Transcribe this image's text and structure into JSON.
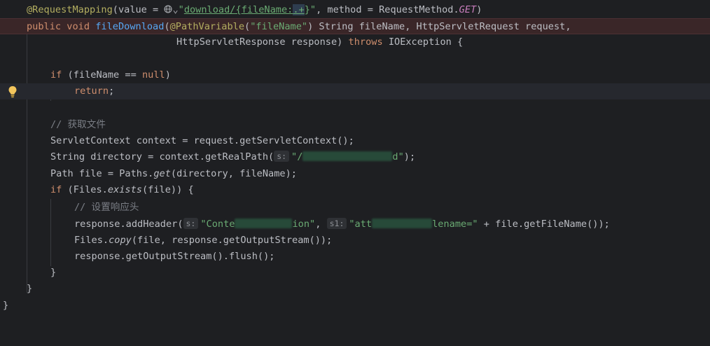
{
  "editor": {
    "lines": {
      "l1": {
        "annotation": "@RequestMapping",
        "p1": "(value = ",
        "chevron": "⌄",
        "q1": "\"",
        "path_a": "download/{fileName:",
        "regex": ".+",
        "path_b": "}\"",
        "p2": ", method = RequestMethod.",
        "get": "GET",
        "p3": ")"
      },
      "l2": {
        "kw_public": "public",
        "kw_void": " void ",
        "method": "fileDownload",
        "p1": "(",
        "path_var": "@PathVariable",
        "p2": "(",
        "str": "\"fileName\"",
        "p3": ") String fileName, HttpServletRequest request,"
      },
      "l3": {
        "p1": "HttpServletResponse response) ",
        "kw_throws": "throws",
        "p2": " IOException {"
      },
      "l4": {
        "kw_if": "if",
        "p1": " (fileName == ",
        "kw_null": "null",
        "p2": ")"
      },
      "l5": {
        "kw_return": "return",
        "p1": ";"
      },
      "l6": {
        "comment": "// 获取文件"
      },
      "l7": {
        "text": "ServletContext context = request.getServletContext();"
      },
      "l8": {
        "p1": "String directory = context.getRealPath(",
        "hint": "s:",
        "str_a": "\"/",
        "str_b": "d\"",
        "p2": ");"
      },
      "l9": {
        "p1": "Path file = Paths.",
        "get": "get",
        "p2": "(directory, fileName);"
      },
      "l10": {
        "kw_if": "if",
        "p1": " (Files.",
        "exists": "exists",
        "p2": "(file)) {"
      },
      "l11": {
        "comment": "// 设置响应头"
      },
      "l12": {
        "p1": "response.addHeader(",
        "hint1": "s:",
        "str1_a": "\"Conte",
        "str1_b": "ion\"",
        "p2": ", ",
        "hint2": "s1:",
        "str2_a": "\"att",
        "str2_b": "lename=\"",
        "p3": " + file.getFileName());"
      },
      "l13": {
        "p1": "Files.",
        "copy": "copy",
        "p2": "(file, response.getOutputStream());"
      },
      "l14": {
        "text": "response.getOutputStream().flush();"
      },
      "l15": {
        "text": "}"
      },
      "l16": {
        "text": "}"
      },
      "l17": {
        "text": "}"
      }
    },
    "colors": {
      "background": "#1e1f22",
      "keyword": "#cf8e6d",
      "annotation": "#b3ae60",
      "string": "#6aab73",
      "method": "#56a8f5",
      "comment": "#7a7e85",
      "static_call": "#c77dbb",
      "breakpoint_line": "#3a2628"
    },
    "icons": [
      "globe-icon",
      "lightbulb-icon"
    ]
  }
}
